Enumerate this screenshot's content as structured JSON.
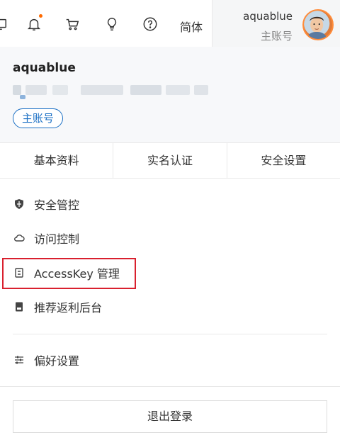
{
  "topbar": {
    "icons": [
      "monitor-icon",
      "bell-icon",
      "cart-icon",
      "lightbulb-icon",
      "help-icon"
    ],
    "language": "简体",
    "notification_color": "#ff6a00",
    "user": {
      "name": "aquablue",
      "type": "主账号"
    }
  },
  "profile": {
    "name": "aquablue",
    "badge": "主账号",
    "badge_color": "#1a6fc4"
  },
  "tabs": [
    "基本资料",
    "实名认证",
    "安全设置"
  ],
  "menu": [
    {
      "label": "安全管控",
      "icon": "shield-icon"
    },
    {
      "label": "访问控制",
      "icon": "cloud-icon"
    },
    {
      "label": "AccessKey 管理",
      "icon": "key-icon",
      "highlighted": true
    },
    {
      "label": "推荐返利后台",
      "icon": "document-icon"
    },
    {
      "label": "偏好设置",
      "icon": "sliders-icon"
    }
  ],
  "logout": "退出登录",
  "highlight_color": "#d9202e"
}
